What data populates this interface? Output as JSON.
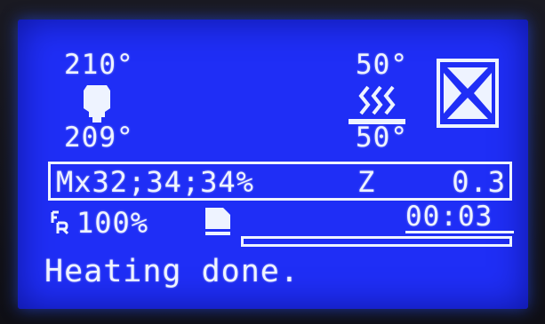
{
  "nozzle": {
    "target": "210°",
    "current": "209°"
  },
  "bed": {
    "target": "50°",
    "current": "50°"
  },
  "status_line": {
    "position": "Mx32;34;34%",
    "z_label": "Z",
    "z_value": "0.3"
  },
  "feedrate": "100%",
  "print_time": "00:03",
  "progress": 0,
  "message": "Heating done.",
  "icons": {
    "nozzle": "hotend-icon",
    "bed": "heated-bed-icon",
    "fan": "fan-icon",
    "feedrate": "feedrate-icon",
    "sd": "sd-card-icon"
  },
  "colors": {
    "lcd_background": "#1f2ef6",
    "lcd_foreground": "#eef3ff"
  }
}
